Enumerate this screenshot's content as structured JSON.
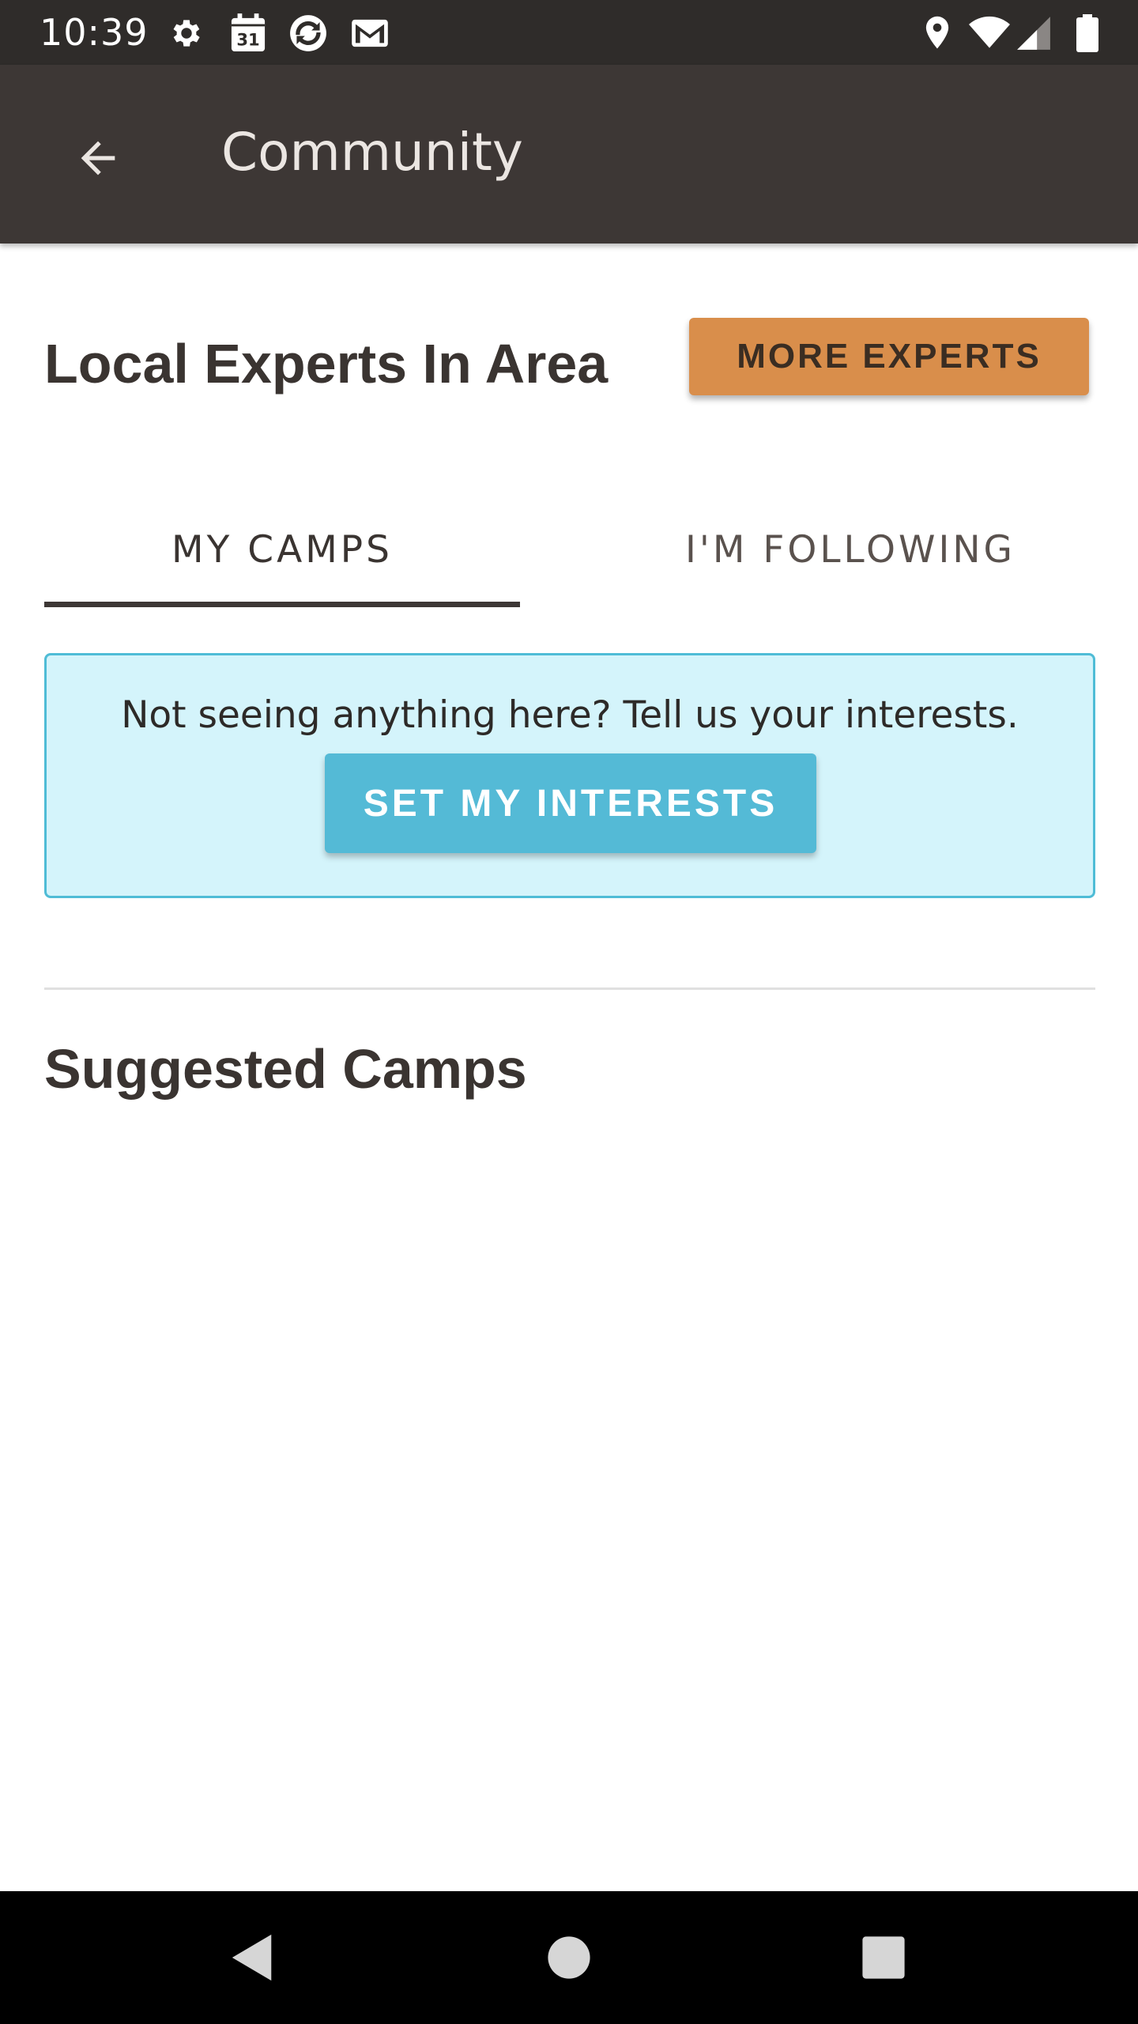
{
  "status_bar": {
    "time": "10:39",
    "left_icons": [
      "settings-icon",
      "calendar-icon",
      "sync-app-icon",
      "gmail-icon"
    ],
    "calendar_day": "31",
    "right_icons": [
      "location-icon",
      "wifi-icon",
      "signal-icon",
      "battery-icon"
    ]
  },
  "app_bar": {
    "title": "Community",
    "back_icon": "arrow-back-icon"
  },
  "experts": {
    "title": "Local Experts In Area",
    "more_button": "MORE EXPERTS"
  },
  "tabs": [
    {
      "label": "MY CAMPS",
      "selected": true
    },
    {
      "label": "I'M FOLLOWING",
      "selected": false
    }
  ],
  "empty_state": {
    "message": "Not seeing anything here? Tell us your interests.",
    "button": "SET MY INTERESTS"
  },
  "suggested": {
    "title": "Suggested Camps"
  },
  "nav_bar": {
    "icons": [
      "nav-back-icon",
      "nav-home-icon",
      "nav-recents-icon"
    ]
  },
  "colors": {
    "status_bar": "#2f2c2a",
    "app_bar": "#3d3735",
    "accent_orange": "#d98e4b",
    "accent_blue": "#54bad6",
    "info_box_bg": "#d4f4fb"
  }
}
